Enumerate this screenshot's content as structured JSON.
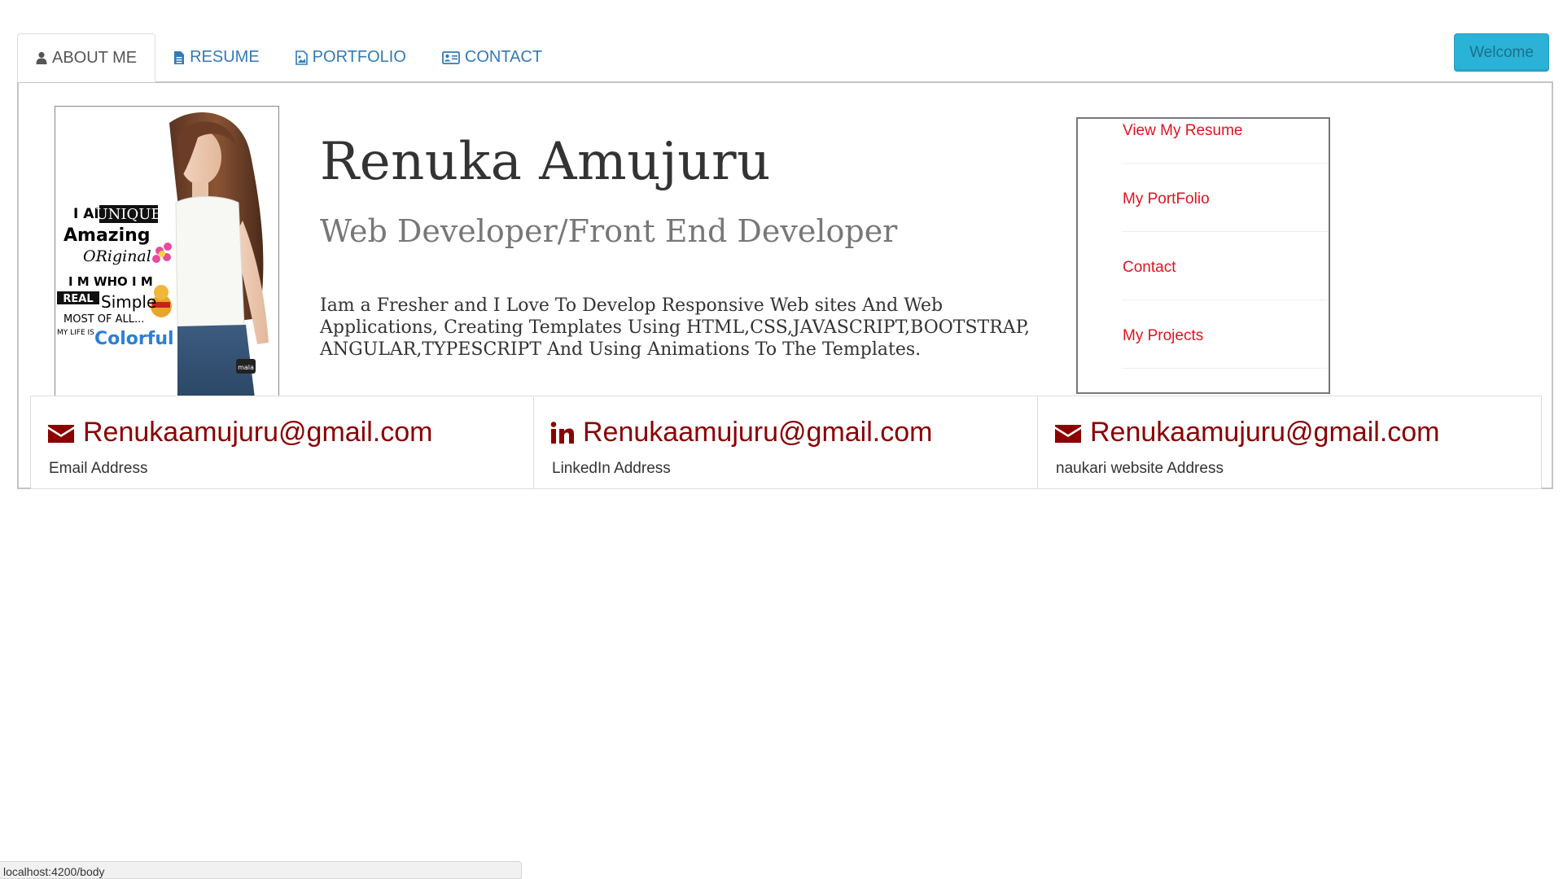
{
  "tabs": [
    {
      "label": "ABOUT ME",
      "icon": "user-icon",
      "active": true
    },
    {
      "label": "RESUME",
      "icon": "file-text-icon",
      "active": false
    },
    {
      "label": "PORTFOLIO",
      "icon": "image-icon",
      "active": false
    },
    {
      "label": "CONTACT",
      "icon": "id-card-icon",
      "active": false
    }
  ],
  "welcome_button": {
    "label": "Welcome"
  },
  "profile": {
    "name": "Renuka Amujuru",
    "title": "Web Developer/Front End Developer",
    "bio": "Iam a Fresher and I Love To Develop Responsive Web sites And Web Applications, Creating Templates Using HTML,CSS,JAVASCRIPT,BOOTSTRAP, ANGULAR,TYPESCRIPT And Using Animations To The Templates.",
    "photo_text": {
      "line1_a": "I AM",
      "line1_b": "UNIQUE",
      "line2": "Amazing",
      "line3": "ORiginal",
      "line4": "I M WHO I M",
      "line5_a": "REAL",
      "line5_b": "Simple",
      "line6": "MOST OF ALL...",
      "line7_a": "MY LIFE IS",
      "line7_b": "Colorful",
      "badge": "mala"
    }
  },
  "side_menu": {
    "items": [
      {
        "label": "View My Resume"
      },
      {
        "label": "My PortFolio"
      },
      {
        "label": "Contact"
      },
      {
        "label": "My Projects"
      }
    ]
  },
  "contacts": [
    {
      "value": "Renukaamujuru@gmail.com",
      "label": "Email Address",
      "icon": "envelope-icon"
    },
    {
      "value": "Renukaamujuru@gmail.com",
      "label": "LinkedIn Address",
      "icon": "linkedin-icon"
    },
    {
      "value": "Renukaamujuru@gmail.com",
      "label": "naukari website Address",
      "icon": "envelope-icon"
    }
  ],
  "status_bar": {
    "url": "localhost:4200/body"
  },
  "colors": {
    "link_blue": "#337ab7",
    "menu_red": "#e0141f",
    "contact_red": "#8b0000",
    "welcome_bg": "#2ab3d6"
  }
}
